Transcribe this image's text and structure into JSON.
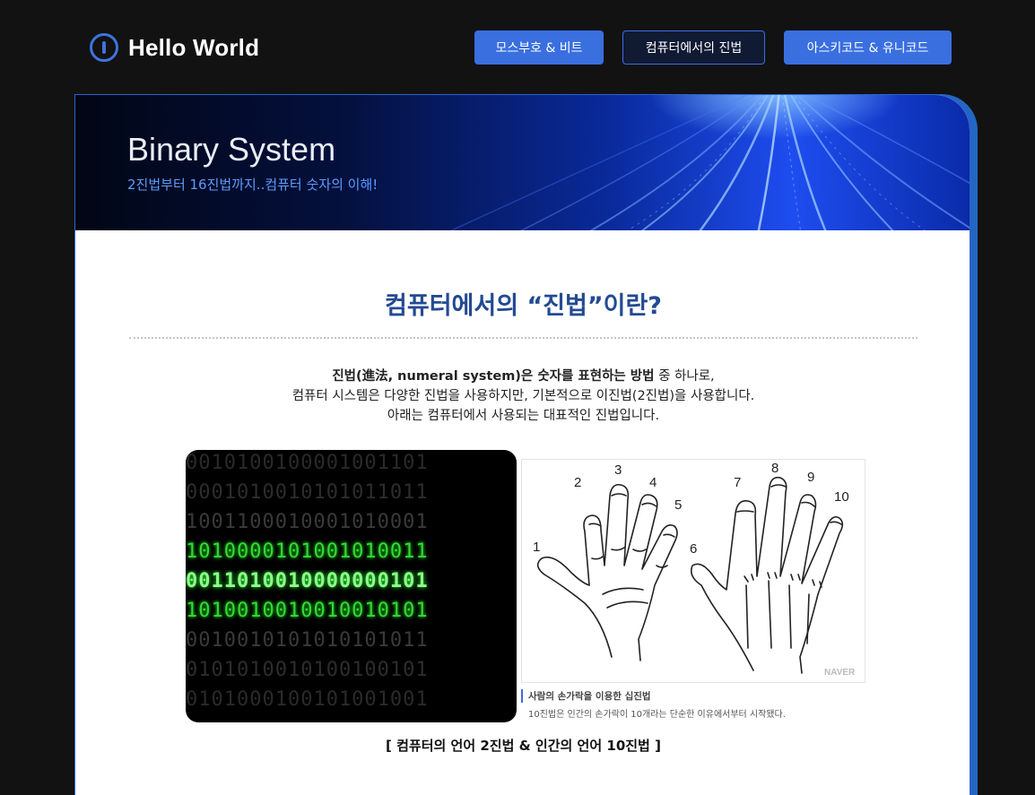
{
  "header": {
    "logo_text": "Hello World",
    "nav": [
      {
        "label": "모스부호 & 비트",
        "active": false
      },
      {
        "label": "컴퓨터에서의 진법",
        "active": true
      },
      {
        "label": "아스키코드 & 유니코드",
        "active": false
      }
    ]
  },
  "banner": {
    "title": "Binary System",
    "subtitle": "2진법부터 16진법까지..컴퓨터 숫자의 이해!"
  },
  "content": {
    "title": "컴퓨터에서의 “진법”이란?",
    "desc_line1_bold": "진법(進法, numeral system)은 숫자를 표현하는 방법",
    "desc_line1_rest": " 중 하나로,",
    "desc_line2": "컴퓨터 시스템은 다양한 진법을 사용하지만, 기본적으로 이진법(2진법)을 사용합니다.",
    "desc_line3": "아래는 컴퓨터에서 사용되는 대표적인 진법입니다."
  },
  "binary_image": {
    "rows": [
      "0010100100001001101",
      "0001010010101011011",
      "1001100010001010001",
      "1010000101001010011",
      "0011010010000000101",
      "1010010010010010101",
      "0010010101010101011",
      "0101010010100100101",
      "0101000100101001001"
    ]
  },
  "hand_image": {
    "numbers": [
      "1",
      "2",
      "3",
      "4",
      "5",
      "6",
      "7",
      "8",
      "9",
      "10"
    ],
    "watermark": "NAVER",
    "caption_title": "사람의 손가락을 이용한 십진법",
    "caption_text": "10진법은 인간의 손가락이 10개라는 단순한 이유에서부터 시작됐다."
  },
  "bottom_caption": "[ 컴퓨터의 언어 2진법 & 인간의 언어 10진법 ]",
  "colors": {
    "accent": "#3a6fe0",
    "title": "#234a92",
    "page_bg": "#121212",
    "binary_green": "#3cff3c"
  }
}
